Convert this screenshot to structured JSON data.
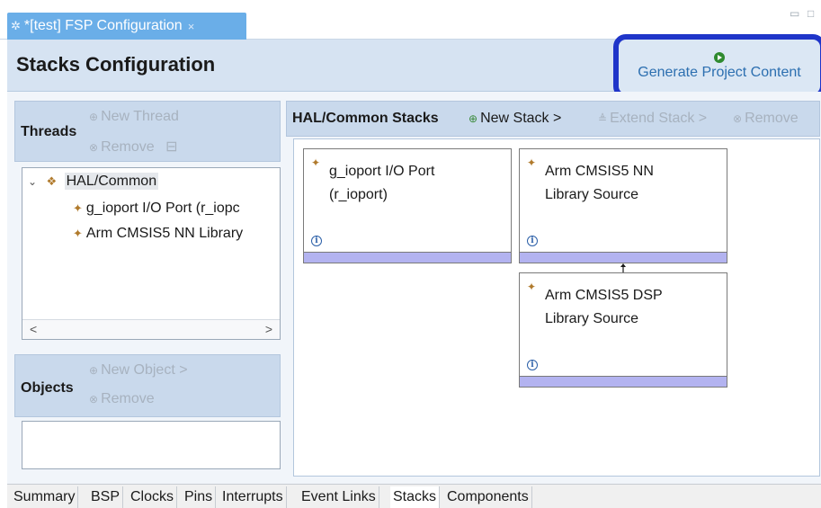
{
  "editor_tab": {
    "title": "*[test] FSP Configuration",
    "close": "×",
    "gear": "✲"
  },
  "window_controls": {
    "minimize": "▭",
    "maximize": "□"
  },
  "header": {
    "title": "Stacks Configuration",
    "generate_label": "Generate Project Content"
  },
  "threads": {
    "label": "Threads",
    "new_thread": "New Thread",
    "remove": "Remove",
    "tree": {
      "root": "HAL/Common",
      "items": [
        "g_ioport I/O Port (r_iopc",
        "Arm CMSIS5 NN Library"
      ]
    },
    "scroll_left": "<",
    "scroll_right": ">"
  },
  "objects": {
    "label": "Objects",
    "new_object": "New Object >",
    "remove": "Remove"
  },
  "stacks": {
    "label": "HAL/Common Stacks",
    "new_stack": "New Stack >",
    "extend_stack": "Extend Stack >",
    "remove": "Remove",
    "cards": [
      {
        "line1": "g_ioport I/O Port",
        "line2": "(r_ioport)"
      },
      {
        "line1": "Arm CMSIS5 NN",
        "line2": "Library Source"
      },
      {
        "line1": "Arm CMSIS5 DSP",
        "line2": "Library Source"
      }
    ],
    "info_glyph": "i"
  },
  "bottom_tabs": [
    "Summary",
    "BSP",
    "Clocks",
    "Pins",
    "Interrupts",
    "Event Links",
    "Stacks",
    "Components"
  ],
  "active_bottom_tab": "Stacks",
  "colors": {
    "accent_tab": "#6aaee8",
    "highlight_border": "#1f35c9",
    "stack_bar": "#b3b3f0"
  }
}
